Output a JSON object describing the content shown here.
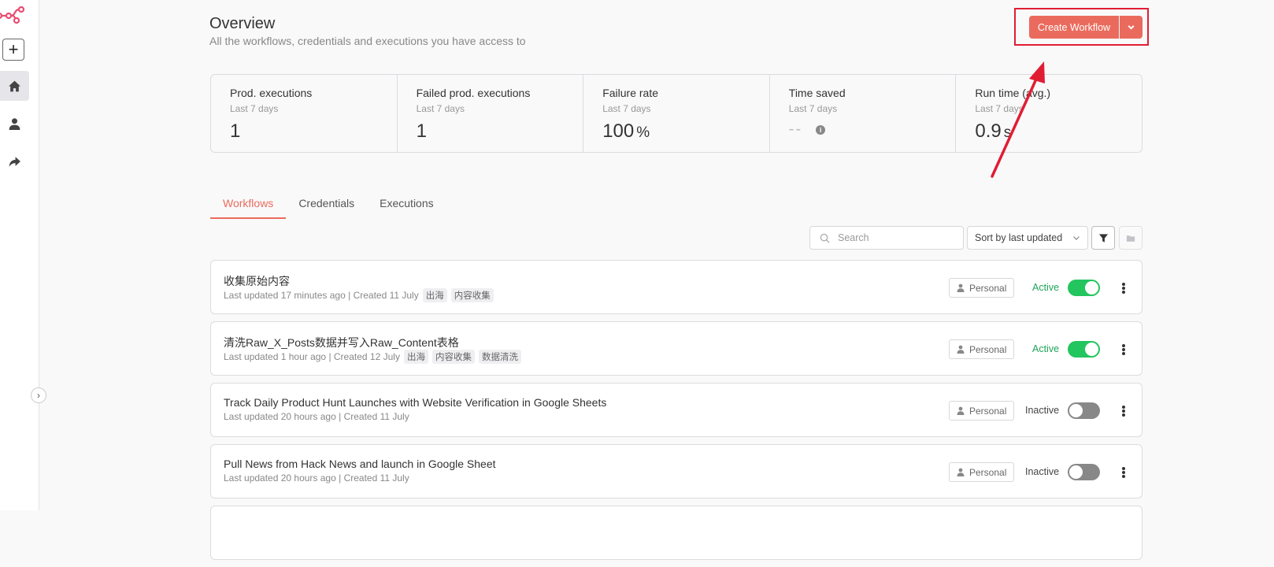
{
  "page": {
    "title": "Overview",
    "subtitle": "All the workflows, credentials and executions you have access to"
  },
  "actions": {
    "create_workflow_label": "Create Workflow"
  },
  "colors": {
    "accent": "#ea6b5d",
    "annotation": "#e11d33",
    "active_green": "#22c55e"
  },
  "stats": [
    {
      "label": "Prod. executions",
      "period": "Last 7 days",
      "value": "1",
      "unit": ""
    },
    {
      "label": "Failed prod. executions",
      "period": "Last 7 days",
      "value": "1",
      "unit": ""
    },
    {
      "label": "Failure rate",
      "period": "Last 7 days",
      "value": "100",
      "unit": "%"
    },
    {
      "label": "Time saved",
      "period": "Last 7 days",
      "value": "--",
      "unit": ""
    },
    {
      "label": "Run time (avg.)",
      "period": "Last 7 days",
      "value": "0.9",
      "unit": "s"
    }
  ],
  "tabs": [
    "Workflows",
    "Credentials",
    "Executions"
  ],
  "toolbar": {
    "search_placeholder": "Search",
    "sort_label": "Sort by last updated"
  },
  "workflows": [
    {
      "name": "收集原始内容",
      "meta": "Last updated 17 minutes ago | Created 11 July",
      "tags": [
        "出海",
        "内容收集"
      ],
      "owner": "Personal",
      "status": "Active",
      "active": true
    },
    {
      "name": "清洗Raw_X_Posts数据并写入Raw_Content表格",
      "meta": "Last updated 1 hour ago | Created 12 July",
      "tags": [
        "出海",
        "内容收集",
        "数据清洗"
      ],
      "owner": "Personal",
      "status": "Active",
      "active": true
    },
    {
      "name": "Track Daily Product Hunt Launches with Website Verification in Google Sheets",
      "meta": "Last updated 20 hours ago | Created 11 July",
      "tags": [],
      "owner": "Personal",
      "status": "Inactive",
      "active": false
    },
    {
      "name": "Pull News from Hack News and launch in Google Sheet",
      "meta": "Last updated 20 hours ago | Created 11 July",
      "tags": [],
      "owner": "Personal",
      "status": "Inactive",
      "active": false
    }
  ]
}
